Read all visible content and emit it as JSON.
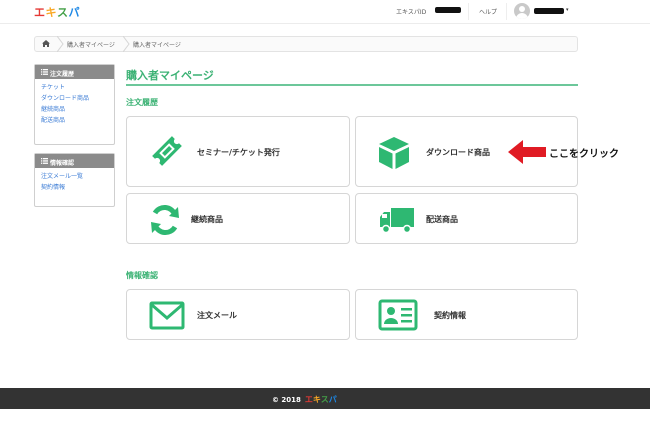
{
  "header": {
    "logo": [
      "エ",
      "キ",
      "ス",
      "パ"
    ],
    "logo_colors": [
      "#e53935",
      "#f9a825",
      "#43a047",
      "#1e88e5"
    ],
    "user_id_label": "エキスパID",
    "help_label": "ヘルプ",
    "caret": "▾"
  },
  "breadcrumb": {
    "items": [
      "購入者マイページ",
      "購入者マイページ"
    ]
  },
  "sidebar": {
    "order_history": {
      "title": "注文履歴",
      "items": [
        "チケット",
        "ダウンロード商品",
        "継続商品",
        "配送商品"
      ]
    },
    "info_confirm": {
      "title": "情報確認",
      "items": [
        "注文メール一覧",
        "契約情報"
      ]
    }
  },
  "main": {
    "title": "購入者マイページ",
    "order_history_title": "注文履歴",
    "info_confirm_title": "情報確認",
    "cards": {
      "seminar": "セミナー/チケット発行",
      "download": "ダウンロード商品",
      "recurring": "継続商品",
      "shipping": "配送商品",
      "order_mail": "注文メール",
      "contract": "契約情報"
    },
    "accent_color": "#3bb274"
  },
  "annotation": {
    "text": "ここをクリック",
    "arrow_color": "#e01b24"
  },
  "footer": {
    "copyright": "© 2018"
  }
}
